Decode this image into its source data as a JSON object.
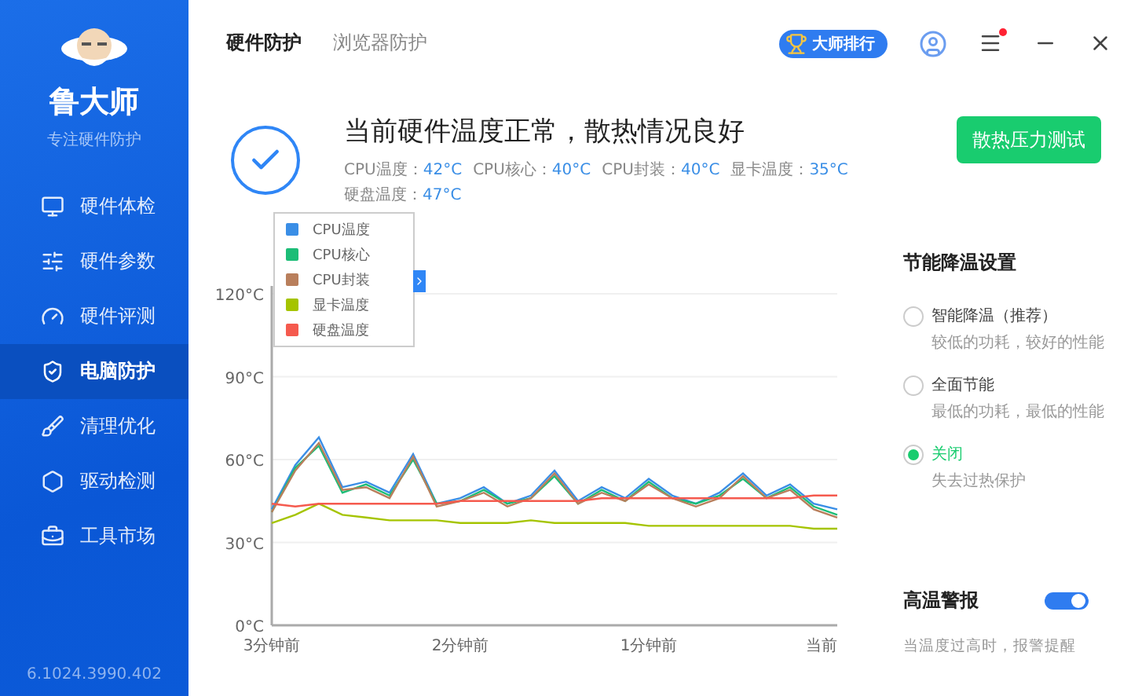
{
  "sidebar": {
    "brand": "鲁大师",
    "tagline": "专注硬件防护",
    "items": [
      {
        "label": "硬件体检",
        "selected": false
      },
      {
        "label": "硬件参数",
        "selected": false
      },
      {
        "label": "硬件评测",
        "selected": false
      },
      {
        "label": "电脑防护",
        "selected": true
      },
      {
        "label": "清理优化",
        "selected": false
      },
      {
        "label": "驱动检测",
        "selected": false
      },
      {
        "label": "工具市场",
        "selected": false
      }
    ],
    "version": "6.1024.3990.402"
  },
  "tabs": [
    {
      "label": "硬件防护",
      "selected": true
    },
    {
      "label": "浏览器防护",
      "selected": false
    }
  ],
  "header": {
    "ranking_badge": "大师排行",
    "menu_notification": true
  },
  "status": {
    "title": "当前硬件温度正常，散热情况良好",
    "readings": [
      {
        "label": "CPU温度：",
        "value": "42°C"
      },
      {
        "label": "CPU核心：",
        "value": "40°C"
      },
      {
        "label": "CPU封装：",
        "value": "40°C"
      },
      {
        "label": "显卡温度：",
        "value": "35°C"
      },
      {
        "label": "硬盘温度：",
        "value": "47°C"
      }
    ],
    "stress_test_button": "散热压力测试"
  },
  "chart_data": {
    "type": "line",
    "grid": true,
    "legend": true,
    "x": [
      -3,
      -2.875,
      -2.75,
      -2.625,
      -2.5,
      -2.375,
      -2.25,
      -2.125,
      -2,
      -1.875,
      -1.75,
      -1.625,
      -1.5,
      -1.375,
      -1.25,
      -1.125,
      -1,
      -0.875,
      -0.75,
      -0.625,
      -0.5,
      -0.375,
      -0.25,
      -0.125,
      0
    ],
    "xlim": [
      -3,
      0
    ],
    "xticks": [
      {
        "value": -3,
        "label": "3分钟前"
      },
      {
        "value": -2,
        "label": "2分钟前"
      },
      {
        "value": -1,
        "label": "1分钟前"
      },
      {
        "value": 0,
        "label": "当前"
      }
    ],
    "ylim": [
      0,
      120
    ],
    "yticks": [
      {
        "value": 0,
        "label": "0°C"
      },
      {
        "value": 30,
        "label": "30°C"
      },
      {
        "value": 60,
        "label": "60°C"
      },
      {
        "value": 90,
        "label": "90°C"
      },
      {
        "value": 120,
        "label": "120°C"
      }
    ],
    "series": [
      {
        "name": "CPU温度",
        "color": "#3a8ee6",
        "values": [
          42,
          58,
          68,
          50,
          52,
          48,
          62,
          44,
          46,
          50,
          44,
          47,
          56,
          45,
          50,
          46,
          53,
          47,
          44,
          48,
          55,
          47,
          51,
          44,
          42
        ]
      },
      {
        "name": "CPU核心",
        "color": "#1cbd77",
        "values": [
          41,
          57,
          65,
          48,
          51,
          47,
          60,
          44,
          45,
          49,
          44,
          46,
          54,
          44,
          49,
          45,
          52,
          46,
          44,
          47,
          53,
          46,
          50,
          43,
          40
        ]
      },
      {
        "name": "CPU封装",
        "color": "#b97f5c",
        "values": [
          41,
          56,
          66,
          49,
          50,
          46,
          61,
          43,
          45,
          48,
          43,
          46,
          55,
          44,
          48,
          45,
          51,
          46,
          43,
          46,
          54,
          46,
          49,
          42,
          39
        ]
      },
      {
        "name": "显卡温度",
        "color": "#a5c400",
        "values": [
          37,
          40,
          44,
          40,
          39,
          38,
          38,
          38,
          37,
          37,
          37,
          38,
          37,
          37,
          37,
          37,
          36,
          36,
          36,
          36,
          36,
          36,
          36,
          35,
          35
        ]
      },
      {
        "name": "硬盘温度",
        "color": "#f55a4e",
        "values": [
          44,
          43,
          44,
          44,
          44,
          44,
          44,
          44,
          45,
          45,
          45,
          45,
          45,
          45,
          46,
          46,
          46,
          46,
          46,
          46,
          46,
          46,
          46,
          47,
          47
        ]
      }
    ]
  },
  "cooling_settings": {
    "title": "节能降温设置",
    "options": [
      {
        "label": "智能降温（推荐）",
        "description": "较低的功耗，较好的性能",
        "selected": false
      },
      {
        "label": "全面节能",
        "description": "最低的功耗，最低的性能",
        "selected": false
      },
      {
        "label": "关闭",
        "description": "失去过热保护",
        "selected": true
      }
    ]
  },
  "high_temp_alert": {
    "title": "高温警报",
    "on": true,
    "description": "当温度过高时，报警提醒"
  }
}
